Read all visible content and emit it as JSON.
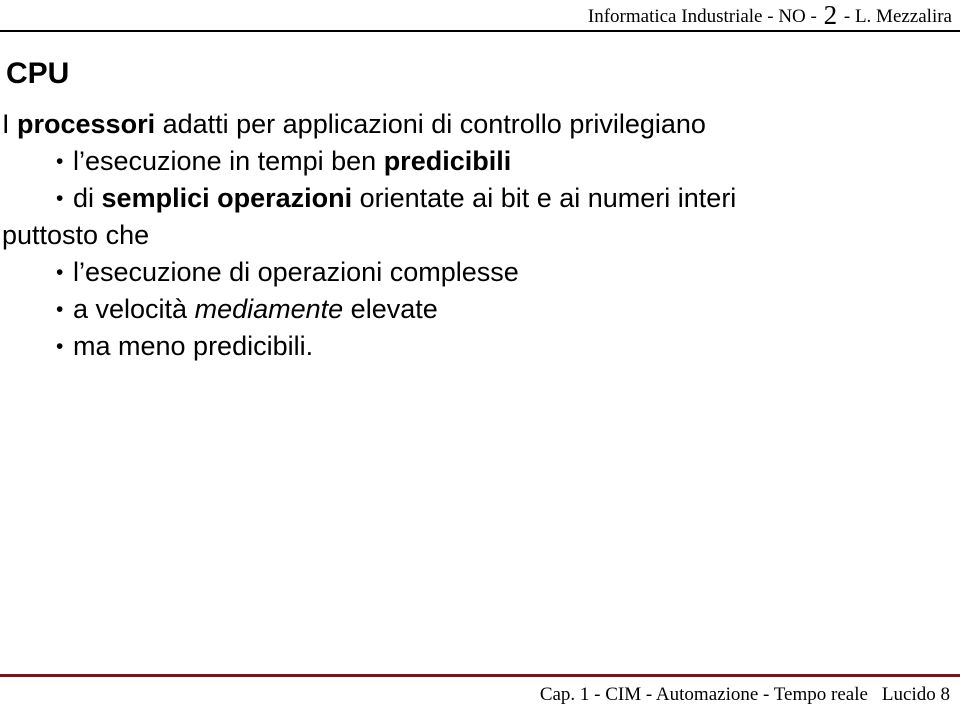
{
  "slide": {
    "header": {
      "course": "Informatica Industriale",
      "sep1": "-",
      "section": "NO",
      "sep2": "-",
      "number": "2",
      "sep3": "-",
      "author": "L. Mezzalira"
    },
    "title": "CPU",
    "body": {
      "lines": [
        {
          "bullet": "",
          "segments": [
            {
              "text": "I ",
              "style": "normal"
            },
            {
              "text": "processori",
              "style": "bold"
            },
            {
              "text": " adatti per applicazioni di controllo privilegiano",
              "style": "normal"
            }
          ]
        },
        {
          "bullet": "•",
          "segments": [
            {
              "text": "l’esecuzione in tempi ben ",
              "style": "normal"
            },
            {
              "text": "predicibili",
              "style": "bold"
            }
          ]
        },
        {
          "bullet": "•",
          "segments": [
            {
              "text": "di ",
              "style": "normal"
            },
            {
              "text": "semplici operazioni",
              "style": "bold"
            },
            {
              "text": " orientate ai bit e ai numeri interi",
              "style": "normal"
            }
          ]
        },
        {
          "bullet": "",
          "segments": [
            {
              "text": "puttosto che",
              "style": "normal"
            }
          ]
        },
        {
          "bullet": "•",
          "segments": [
            {
              "text": "l’esecuzione di operazioni complesse",
              "style": "normal"
            }
          ]
        },
        {
          "bullet": "•",
          "segments": [
            {
              "text": "a velocità ",
              "style": "normal"
            },
            {
              "text": "mediamente",
              "style": "italic"
            },
            {
              "text": " elevate",
              "style": "normal"
            }
          ]
        },
        {
          "bullet": "•",
          "segments": [
            {
              "text": "ma meno predicibili.",
              "style": "normal"
            }
          ]
        }
      ]
    },
    "footer": {
      "chapter": "Cap. 1 - CIM - Automazione - Tempo reale",
      "slide_label": "Lucido 8"
    },
    "colors": {
      "header_rule": "#000000",
      "footer_rule": "#7b1418",
      "text": "#000000",
      "background": "#ffffff"
    }
  }
}
